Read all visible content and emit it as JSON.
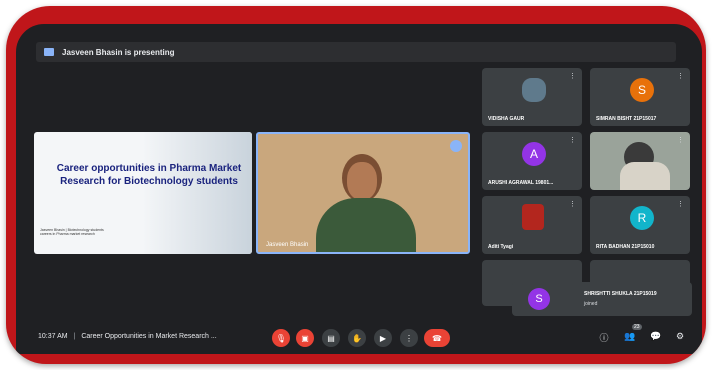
{
  "banner": {
    "text": "Jasveen Bhasin is presenting"
  },
  "slide": {
    "title": "Career opportunities in Pharma Market Research for Biotechnology students",
    "footer": "Jasveen Bhasin | Biotechnology students careers in Pharma market research"
  },
  "speaker": {
    "name": "Jasveen Bhasin"
  },
  "participants": [
    {
      "name": "VIDISHA GAUR",
      "initial": "",
      "color": ""
    },
    {
      "name": "SIMRAN BISHT 21P15017",
      "initial": "S",
      "color": "#e8710a"
    },
    {
      "name": "ARUSHI AGRAWAL 19801...",
      "initial": "A",
      "color": "#9334e6"
    },
    {
      "name": "",
      "initial": "",
      "color": ""
    },
    {
      "name": "Aditi Tyagi",
      "initial": "",
      "color": ""
    },
    {
      "name": "RITA BADHAN 21P15010",
      "initial": "R",
      "color": "#12b5cb"
    }
  ],
  "toast": {
    "initial": "S",
    "name": "SHRISHTTI SHUKLA 21P15019",
    "status": "joined"
  },
  "bottom_bar": {
    "time": "10:37 AM",
    "separator": "|",
    "meeting_title": "Career Opportunities in Market Research ...",
    "people_count": "23"
  },
  "colors": {
    "frame": "#c0161a",
    "end_call": "#ea4335",
    "accent": "#8ab4f8"
  }
}
